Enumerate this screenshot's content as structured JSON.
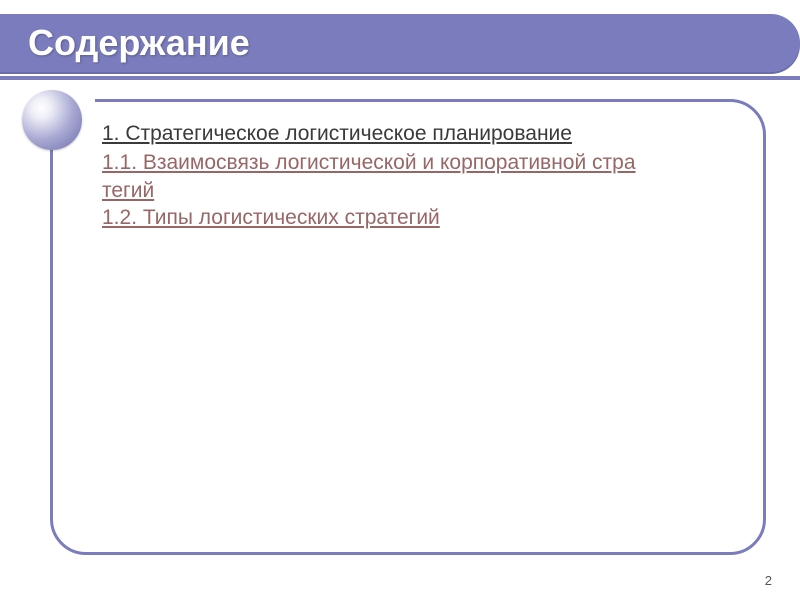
{
  "title": "Содержание",
  "toc": {
    "section1": "1. Стратегическое логистическое планирование",
    "sub11_line1": "1.1. Взаимосвязь логистической и корпоративной стра",
    "sub11_line2": "тегий",
    "sub12": "1.2. Типы логистических стратегий"
  },
  "page_number": "2",
  "colors": {
    "accent": "#7a7cbd",
    "sub_link": "#996666"
  }
}
